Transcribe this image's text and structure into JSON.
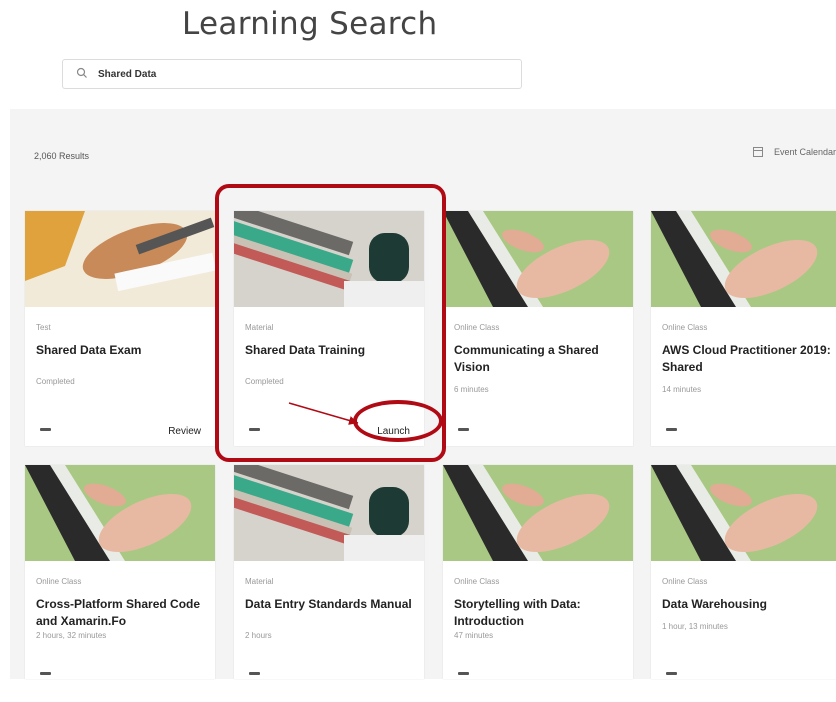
{
  "page": {
    "title": "Learning Search"
  },
  "search": {
    "value": "Shared Data"
  },
  "results": {
    "count_label": "2,060 Results",
    "event_calendar_label": "Event Calendar"
  },
  "cards": [
    {
      "type": "Test",
      "title": "Shared Data Exam",
      "status": "Completed",
      "action": "Review"
    },
    {
      "type": "Material",
      "title": "Shared Data Training",
      "status": "Completed",
      "action": "Launch"
    },
    {
      "type": "Online Class",
      "title": "Communicating a Shared Vision",
      "status": "6 minutes",
      "action": ""
    },
    {
      "type": "Online Class",
      "title": "AWS Cloud Practitioner 2019: Shared",
      "status": "14 minutes",
      "action": ""
    },
    {
      "type": "Online Class",
      "title": "Cross-Platform Shared Code and Xamarin.Fo",
      "status": "2 hours, 32 minutes",
      "action": ""
    },
    {
      "type": "Material",
      "title": "Data Entry Standards Manual",
      "status": "2 hours",
      "action": ""
    },
    {
      "type": "Online Class",
      "title": "Storytelling with Data: Introduction",
      "status": "47 minutes",
      "action": ""
    },
    {
      "type": "Online Class",
      "title": "Data Warehousing",
      "status": "1 hour, 13 minutes",
      "action": ""
    }
  ],
  "icons": {
    "search": "search-icon",
    "calendar": "calendar-icon",
    "more": "more-options-icon"
  },
  "colors": {
    "annotation": "#b00a14"
  }
}
